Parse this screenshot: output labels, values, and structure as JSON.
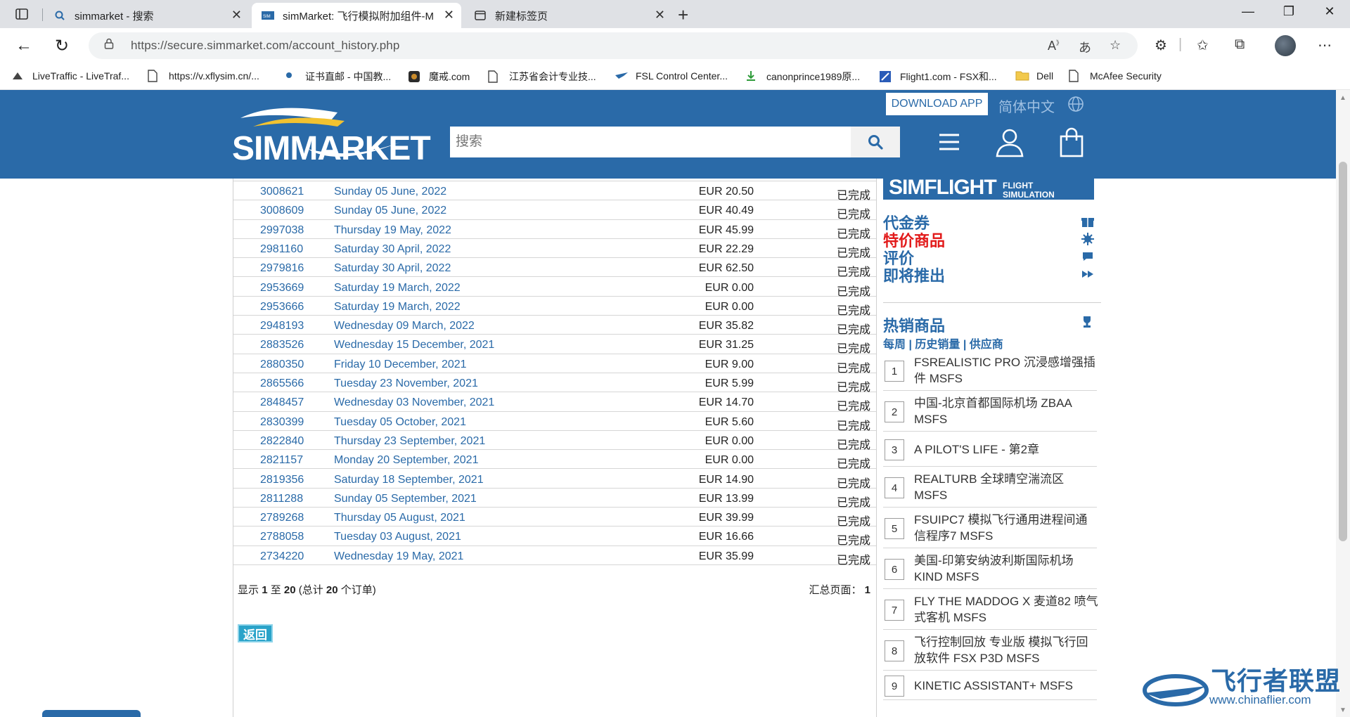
{
  "browser": {
    "tabs": [
      {
        "title": "simmarket - 搜索",
        "active": false
      },
      {
        "title": "simMarket: 飞行模拟附加组件-M",
        "active": true
      },
      {
        "title": "新建标签页",
        "active": false
      }
    ],
    "url": "https://secure.simmarket.com/account_history.php",
    "bookmarks": [
      "LiveTraffic - LiveTraf...",
      "https://v.xflysim.cn/...",
      "证书直邮 - 中国教...",
      "魔戒.com",
      "江苏省会计专业技...",
      "FSL Control Center...",
      "canonprince1989原...",
      "Flight1.com - FSX和...",
      "Dell",
      "McAfee Security"
    ]
  },
  "header": {
    "logo_text": "SIMMARKET",
    "download_app": "DOWNLOAD APP",
    "language": "简体中文",
    "search_placeholder": "搜索"
  },
  "orders": {
    "rows": [
      {
        "id": "3008621",
        "date": "Sunday 05 June, 2022",
        "amount": "EUR 20.50",
        "status": "已完成"
      },
      {
        "id": "3008609",
        "date": "Sunday 05 June, 2022",
        "amount": "EUR 40.49",
        "status": "已完成"
      },
      {
        "id": "2997038",
        "date": "Thursday 19 May, 2022",
        "amount": "EUR 45.99",
        "status": "已完成"
      },
      {
        "id": "2981160",
        "date": "Saturday 30 April, 2022",
        "amount": "EUR 22.29",
        "status": "已完成"
      },
      {
        "id": "2979816",
        "date": "Saturday 30 April, 2022",
        "amount": "EUR 62.50",
        "status": "已完成"
      },
      {
        "id": "2953669",
        "date": "Saturday 19 March, 2022",
        "amount": "EUR 0.00",
        "status": "已完成"
      },
      {
        "id": "2953666",
        "date": "Saturday 19 March, 2022",
        "amount": "EUR 0.00",
        "status": "已完成"
      },
      {
        "id": "2948193",
        "date": "Wednesday 09 March, 2022",
        "amount": "EUR 35.82",
        "status": "已完成"
      },
      {
        "id": "2883526",
        "date": "Wednesday 15 December, 2021",
        "amount": "EUR 31.25",
        "status": "已完成"
      },
      {
        "id": "2880350",
        "date": "Friday 10 December, 2021",
        "amount": "EUR 9.00",
        "status": "已完成"
      },
      {
        "id": "2865566",
        "date": "Tuesday 23 November, 2021",
        "amount": "EUR 5.99",
        "status": "已完成"
      },
      {
        "id": "2848457",
        "date": "Wednesday 03 November, 2021",
        "amount": "EUR 14.70",
        "status": "已完成"
      },
      {
        "id": "2830399",
        "date": "Tuesday 05 October, 2021",
        "amount": "EUR 5.60",
        "status": "已完成"
      },
      {
        "id": "2822840",
        "date": "Thursday 23 September, 2021",
        "amount": "EUR 0.00",
        "status": "已完成"
      },
      {
        "id": "2821157",
        "date": "Monday 20 September, 2021",
        "amount": "EUR 0.00",
        "status": "已完成"
      },
      {
        "id": "2819356",
        "date": "Saturday 18 September, 2021",
        "amount": "EUR 14.90",
        "status": "已完成"
      },
      {
        "id": "2811288",
        "date": "Sunday 05 September, 2021",
        "amount": "EUR 13.99",
        "status": "已完成"
      },
      {
        "id": "2789268",
        "date": "Thursday 05 August, 2021",
        "amount": "EUR 39.99",
        "status": "已完成"
      },
      {
        "id": "2788058",
        "date": "Tuesday 03 August, 2021",
        "amount": "EUR 16.66",
        "status": "已完成"
      },
      {
        "id": "2734220",
        "date": "Wednesday 19 May, 2021",
        "amount": "EUR 35.99",
        "status": "已完成"
      }
    ],
    "summary_prefix": "显示",
    "summary_from": "1",
    "summary_to_word": "至",
    "summary_to": "20",
    "summary_total_prefix": "(总计",
    "summary_total": "20",
    "summary_total_suffix": "个订单)",
    "pages_label": "汇总页面：",
    "pages_value": "1",
    "back_label": "返回"
  },
  "sidebar": {
    "news_big": "SIMFLIGHT",
    "news_small": "FLIGHT SIMULATION NEWS",
    "links": [
      {
        "label": "代金券",
        "icon": "gift-icon",
        "color": "#2a6aa8"
      },
      {
        "label": "特价商品",
        "icon": "burst-icon",
        "color": "#e21b1b"
      },
      {
        "label": "评价",
        "icon": "comment-icon",
        "color": "#2a6aa8"
      },
      {
        "label": "即将推出",
        "icon": "fast-forward-icon",
        "color": "#2a6aa8"
      }
    ],
    "hot_title": "热销商品",
    "hot_sub": "每周 | 历史销量 | 供应商",
    "hot_items": [
      {
        "rank": "1",
        "name": "FSREALISTIC PRO 沉浸感增强插件 MSFS"
      },
      {
        "rank": "2",
        "name": "中国-北京首都国际机场 ZBAA MSFS"
      },
      {
        "rank": "3",
        "name": "A PILOT'S LIFE - 第2章"
      },
      {
        "rank": "4",
        "name": "REALTURB 全球晴空湍流区 MSFS"
      },
      {
        "rank": "5",
        "name": "FSUIPC7 模拟飞行通用进程间通信程序7 MSFS"
      },
      {
        "rank": "6",
        "name": "美国-印第安纳波利斯国际机场 KIND MSFS"
      },
      {
        "rank": "7",
        "name": "FLY THE MADDOG X 麦道82 喷气式客机 MSFS"
      },
      {
        "rank": "8",
        "name": "飞行控制回放 专业版 模拟飞行回放软件 FSX P3D MSFS"
      },
      {
        "rank": "9",
        "name": "KINETIC ASSISTANT+ MSFS"
      }
    ]
  },
  "watermark": {
    "text": "飞行者联盟",
    "url": "www.chinaflier.com"
  },
  "colors": {
    "brand_blue": "#2a6aa8",
    "accent_red": "#e21b1b",
    "back_button": "#2aa3c9"
  }
}
